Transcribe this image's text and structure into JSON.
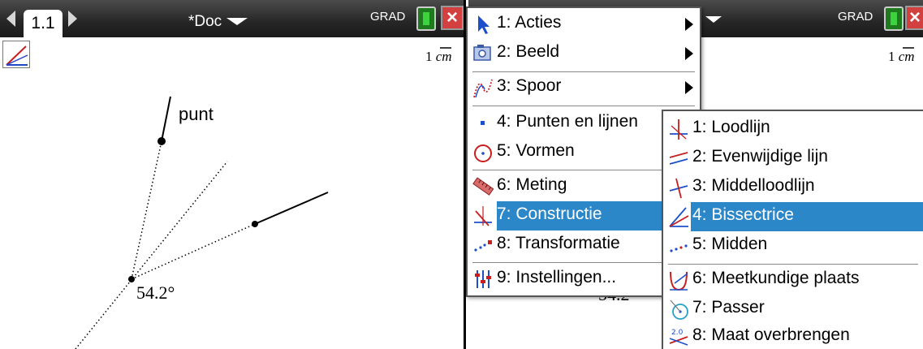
{
  "app": {
    "tab_label": "1.1",
    "doc_title": "*Doc",
    "angle_mode": "GRAD",
    "close_symbol": "×"
  },
  "canvas": {
    "scale_value": "1",
    "scale_unit": "cm",
    "point_label": "punt",
    "angle_measure": "54.2°"
  },
  "right_canvas": {
    "scale_value": "1",
    "scale_unit": "cm",
    "angle_fragment": "54.2"
  },
  "main_menu": {
    "items": [
      {
        "label": "1: Acties",
        "icon": "pointer-arrow-icon",
        "has_submenu": true
      },
      {
        "label": "2: Beeld",
        "icon": "camera-view-icon",
        "has_submenu": true
      },
      {
        "label": "3: Spoor",
        "icon": "trace-icon",
        "has_submenu": true
      },
      {
        "label": "4: Punten en lijnen",
        "icon": "point-icon",
        "has_submenu": false
      },
      {
        "label": "5: Vormen",
        "icon": "circle-icon",
        "has_submenu": false
      },
      {
        "label": "6: Meting",
        "icon": "ruler-icon",
        "has_submenu": false
      },
      {
        "label": "7: Constructie",
        "icon": "construction-icon",
        "has_submenu": false
      },
      {
        "label": "8: Transformatie",
        "icon": "transform-icon",
        "has_submenu": false
      },
      {
        "label": "9: Instellingen...",
        "icon": "settings-sliders-icon",
        "has_submenu": false
      }
    ],
    "selected_index": 6
  },
  "sub_menu": {
    "items": [
      {
        "label": "1: Loodlijn",
        "icon": "perpendicular-icon"
      },
      {
        "label": "2: Evenwijdige lijn",
        "icon": "parallel-icon"
      },
      {
        "label": "3: Middelloodlijn",
        "icon": "perpendicular-bisector-icon"
      },
      {
        "label": "4: Bissectrice",
        "icon": "angle-bisector-icon"
      },
      {
        "label": "5: Midden",
        "icon": "midpoint-icon"
      },
      {
        "label": "6: Meetkundige plaats",
        "icon": "locus-icon"
      },
      {
        "label": "7: Passer",
        "icon": "compass-icon"
      },
      {
        "label": "8: Maat overbrengen",
        "icon": "measurement-transfer-icon"
      }
    ],
    "selected_index": 3
  },
  "colors": {
    "selection": "#2c87c9",
    "topbar": "#262626",
    "close_button": "#d34040",
    "battery": "#3fd23f"
  }
}
